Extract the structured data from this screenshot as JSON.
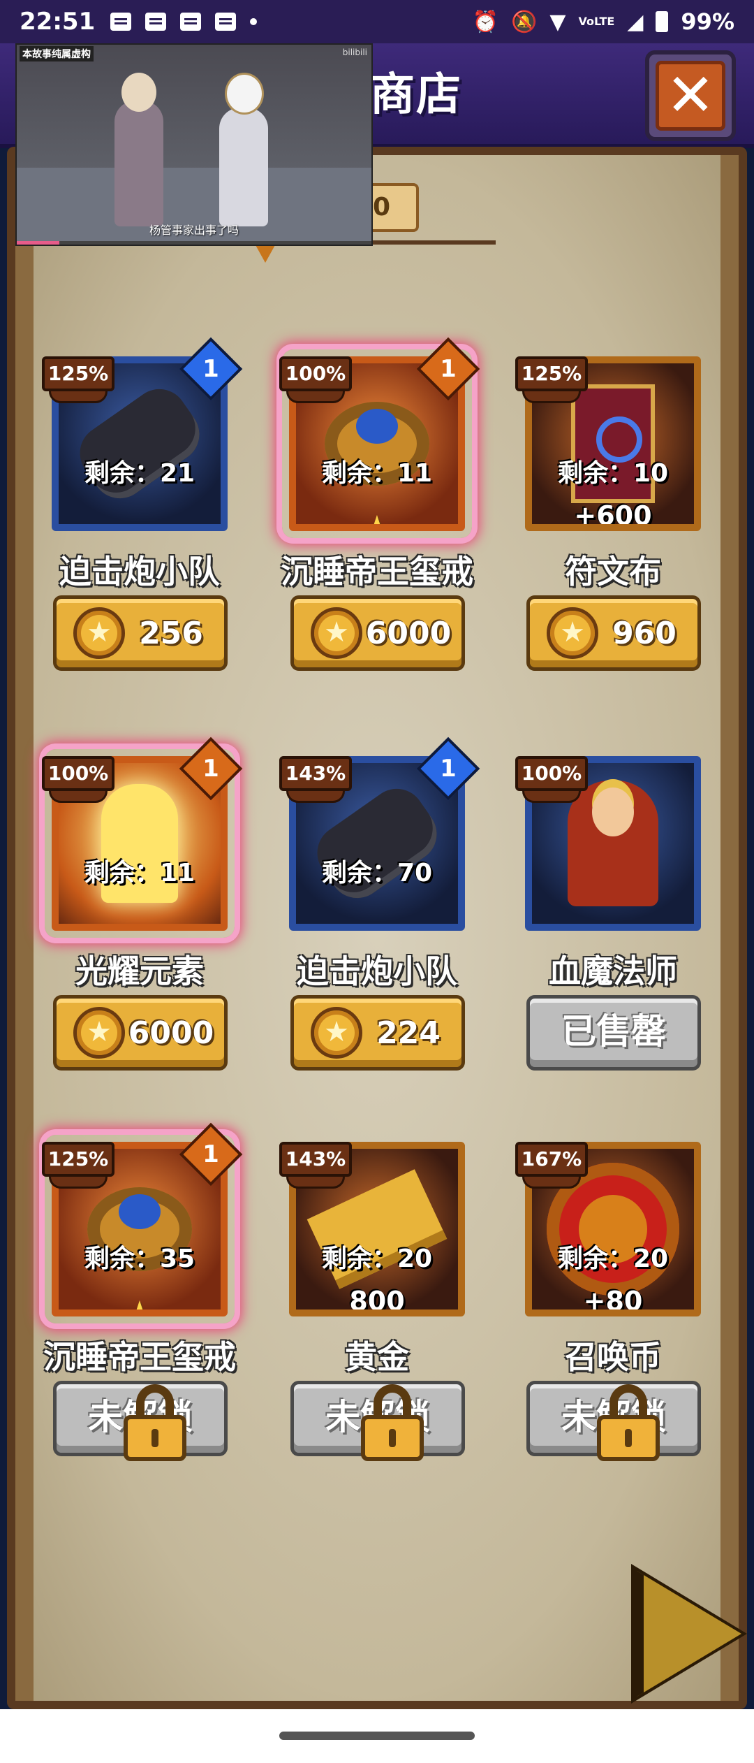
{
  "status_bar": {
    "time": "22:51",
    "battery": "99%",
    "vo_lte": "VoLTE"
  },
  "header": {
    "title": "商店",
    "close_icon": "close-x-icon"
  },
  "video_overlay": {
    "title": "本故事纯属虚构",
    "brand": "bilibili",
    "caption": "杨管事家出事了吗",
    "progress": 0.12
  },
  "partial_counter": "0",
  "items": [
    {
      "name": "迫击炮小队",
      "percent": "125%",
      "tier": "1",
      "tier_color": "blue",
      "frame": "blue",
      "art": "cannon",
      "remaining": "剩余：21",
      "extra": "",
      "star": false,
      "glow": false,
      "price": "256",
      "button": "price"
    },
    {
      "name": "沉睡帝王玺戒",
      "percent": "100%",
      "tier": "1",
      "tier_color": "orange",
      "frame": "orange",
      "art": "ring",
      "remaining": "剩余：11",
      "extra": "",
      "star": true,
      "glow": true,
      "price": "6000",
      "button": "price"
    },
    {
      "name": "符文布",
      "percent": "125%",
      "tier": "",
      "tier_color": "",
      "frame": "gold",
      "art": "scroll",
      "remaining": "剩余：10",
      "extra": "+600",
      "star": false,
      "glow": false,
      "price": "960",
      "button": "price"
    },
    {
      "name": "光耀元素",
      "percent": "100%",
      "tier": "1",
      "tier_color": "orange",
      "frame": "orange",
      "art": "figure",
      "remaining": "剩余：11",
      "extra": "",
      "star": false,
      "glow": true,
      "price": "6000",
      "button": "price"
    },
    {
      "name": "迫击炮小队",
      "percent": "143%",
      "tier": "1",
      "tier_color": "blue",
      "frame": "blue",
      "art": "cannon",
      "remaining": "剩余：70",
      "extra": "",
      "star": false,
      "glow": false,
      "price": "224",
      "button": "price"
    },
    {
      "name": "血魔法师",
      "percent": "100%",
      "tier": "",
      "tier_color": "",
      "frame": "blue",
      "art": "mage",
      "remaining": "",
      "extra": "",
      "star": false,
      "glow": false,
      "price": "",
      "button": "sold",
      "button_label": "已售罄"
    },
    {
      "name": "沉睡帝王玺戒",
      "percent": "125%",
      "tier": "1",
      "tier_color": "orange",
      "frame": "orange",
      "art": "ring",
      "remaining": "剩余：35",
      "extra": "",
      "star": true,
      "glow": true,
      "price": "",
      "button": "locked",
      "button_label": "未解锁"
    },
    {
      "name": "黄金",
      "percent": "143%",
      "tier": "",
      "tier_color": "",
      "frame": "gold",
      "art": "gold",
      "remaining": "剩余：20",
      "extra": "800",
      "star": false,
      "glow": false,
      "price": "",
      "button": "locked",
      "button_label": "未解锁"
    },
    {
      "name": "召唤币",
      "percent": "167%",
      "tier": "",
      "tier_color": "",
      "frame": "gold",
      "art": "coin",
      "remaining": "剩余：20",
      "extra": "+80",
      "star": false,
      "glow": false,
      "price": "",
      "button": "locked",
      "button_label": "未解锁"
    }
  ],
  "icons": {
    "coin": "gold-star-coin-icon",
    "lock": "padlock-icon",
    "next": "next-page-arrow-icon",
    "star": "star-icon"
  }
}
